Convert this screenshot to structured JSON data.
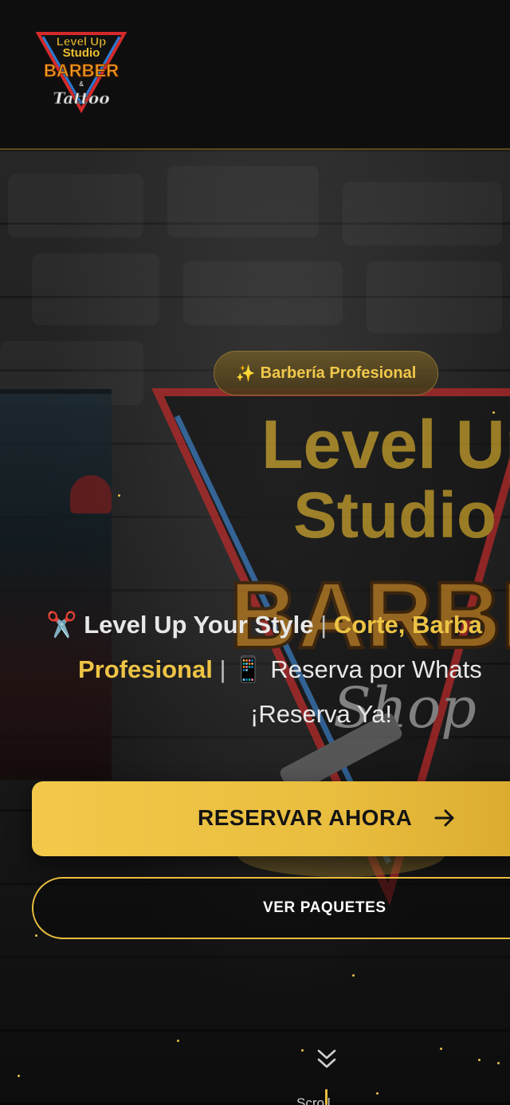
{
  "header": {
    "logo": {
      "line1": "Level Up",
      "line2": "Studio",
      "line3": "BARBER",
      "line4": "&",
      "line5": "Tattoo",
      "colors": {
        "gold": "#f0c030",
        "red": "#d42a2a",
        "blue": "#2a7ad4"
      }
    }
  },
  "hero": {
    "badge": {
      "icon": "✨",
      "label": "Barbería Profesional"
    },
    "tagline": {
      "icon_scissors": "✂️",
      "part1": "Level Up Your Style",
      "separator": "|",
      "part2": "Corte, Barba",
      "part3": "Profesional",
      "icon_phone": "📱",
      "part4": "Reserva por Whats",
      "part5": "¡Reserva Ya!"
    },
    "background_sign": {
      "line1": "Level Up",
      "line2": "Studio",
      "line3": "BARBE",
      "line4": "Shop"
    },
    "primary_button": {
      "label": "RESERVAR AHORA"
    },
    "secondary_button": {
      "label": "VER PAQUETES"
    },
    "scroll": {
      "label": "Scroll"
    }
  },
  "colors": {
    "accent": "#e9bd3e",
    "background": "#0d0d0d"
  },
  "icons": [
    "logo-icon",
    "sparkles-icon",
    "scissors-icon",
    "phone-icon",
    "arrow-right-icon",
    "chevron-double-down-icon"
  ]
}
